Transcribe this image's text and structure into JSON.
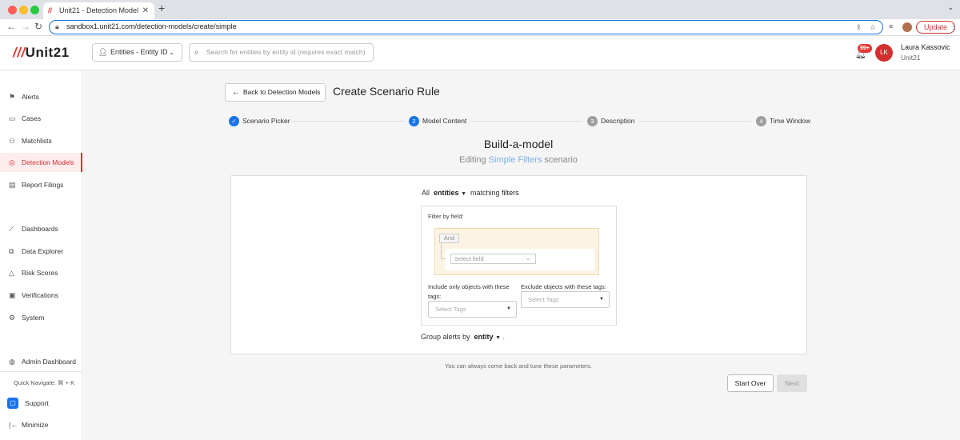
{
  "browser": {
    "tab_title": "Unit21 - Detection Model",
    "url": "sandbox1.unit21.com/detection-models/create/simple",
    "update_label": "Update"
  },
  "header": {
    "logo": "Unit21",
    "entity_select": "Entities - Entity ID",
    "search_placeholder": "Search for entities by entity id (requires exact match)",
    "notif_badge": "99+",
    "avatar_initials": "LK",
    "user_name": "Laura Kassovic",
    "user_org": "Unit21"
  },
  "sidebar": {
    "items": [
      {
        "label": "Alerts"
      },
      {
        "label": "Cases"
      },
      {
        "label": "Matchlists"
      },
      {
        "label": "Detection Models"
      },
      {
        "label": "Report Filings"
      },
      {
        "label": "Dashboards"
      },
      {
        "label": "Data Explorer"
      },
      {
        "label": "Risk Scores"
      },
      {
        "label": "Verifications"
      },
      {
        "label": "System"
      },
      {
        "label": "Admin Dashboard"
      }
    ],
    "quick_navigate": "Quick Navigate: ⌘ + K",
    "support": "Support",
    "minimize": "Minimize"
  },
  "page": {
    "back_button": "Back to Detection Models",
    "title": "Create Scenario Rule",
    "steps": [
      {
        "num": "✓",
        "label": "Scenario Picker"
      },
      {
        "num": "2",
        "label": "Model Content"
      },
      {
        "num": "3",
        "label": "Description"
      },
      {
        "num": "4",
        "label": "Time Window"
      }
    ],
    "heading": "Build-a-model",
    "editing_prefix": "Editing",
    "editing_link": "Simple Filters",
    "editing_suffix": "scenario",
    "all_label": "All",
    "entities_select": "entities",
    "matching_label": "matching",
    "filters_label": "filters",
    "filter_by_field": "Filter by field:",
    "and_label": "And",
    "select_field": "Select field",
    "include_label": "Include only objects with these tags:",
    "exclude_label": "Exclude objects with these tags:",
    "select_tags": "Select Tags",
    "group_by_label": "Group alerts by",
    "group_by_value": "entity",
    "period": ".",
    "hint": "You can always come back and tune these parameters.",
    "start_over": "Start Over",
    "next": "Next"
  },
  "colors": {
    "accent": "#d32f2f",
    "primary_blue": "#1a73e8",
    "step_inactive": "#9e9e9e"
  }
}
